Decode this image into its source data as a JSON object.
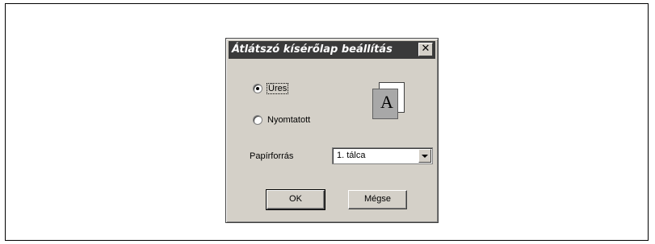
{
  "dialog": {
    "title": "Átlátszó kísérőlap beállítás",
    "close_glyph": "✕",
    "options": [
      {
        "label": "Üres",
        "checked": true
      },
      {
        "label": "Nyomtatott",
        "checked": false
      }
    ],
    "preview_letter": "A",
    "paper_source_label": "Papírforrás",
    "paper_source_value": "1. tálca",
    "ok_label": "OK",
    "cancel_label": "Mégse"
  }
}
